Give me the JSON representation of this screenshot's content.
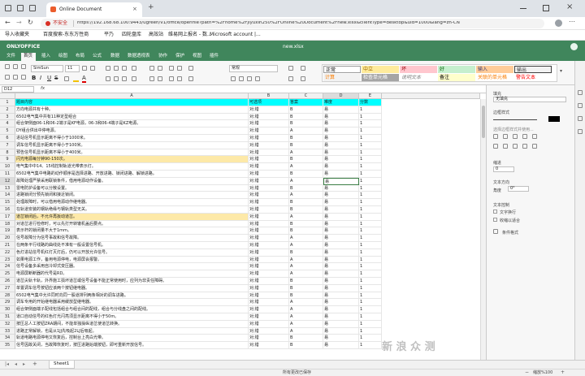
{
  "browser": {
    "tab_title": "Online Document",
    "security_label": "不安全",
    "url": "https://192.168.68.100:9443/ugreen/v1/office/openfile?path=%2Fhome%2Fjiyuxin250%2FOnline%20Document%2Fnew.xlsx&clientType=desktop&uid=1000&lang=zh-CN",
    "bookmarks": [
      "导入收藏夹",
      "百度搜索-东东万性商",
      "平乃",
      "四轮盘库",
      "高效站",
      "维易网上报名 - 数...",
      "Microsoft account |..."
    ]
  },
  "office": {
    "brand": "ONLYOFFICE",
    "doc_title": "new.xlsx",
    "menu_tabs": [
      "文件",
      "首页",
      "插入",
      "绘图",
      "布局",
      "公式",
      "数据",
      "数据透视表",
      "协作",
      "保护",
      "视图",
      "插件"
    ],
    "active_tab": "首页",
    "font_name": "SimSun",
    "font_size": "11",
    "number_format": "常规",
    "cell_styles": [
      {
        "label": "正常",
        "bg": "#ffffff",
        "fg": "#000000"
      },
      {
        "label": "中立",
        "bg": "#ffeb9c",
        "fg": "#9c6500"
      },
      {
        "label": "坏",
        "bg": "#ffc7ce",
        "fg": "#9c0006"
      },
      {
        "label": "好",
        "bg": "#c6efce",
        "fg": "#006100"
      },
      {
        "label": "输入",
        "bg": "#ffcc99",
        "fg": "#3f3f76"
      },
      {
        "label": "输出",
        "bg": "#f2f2f2",
        "fg": "#3f3f3f"
      },
      {
        "label": "计算",
        "bg": "#f2f2f2",
        "fg": "#fa7d00"
      },
      {
        "label": "检查单元格",
        "bg": "#a5a5a5",
        "fg": "#ffffff"
      },
      {
        "label": "说明文本",
        "bg": "#ffffff",
        "fg": "#7f7f7f"
      },
      {
        "label": "备注",
        "bg": "#ffffcc",
        "fg": "#000000"
      },
      {
        "label": "关联的单元格",
        "bg": "#ffffff",
        "fg": "#fa7d00"
      },
      {
        "label": "警告文本",
        "bg": "#ffffff",
        "fg": "#ff0000"
      }
    ],
    "name_box": "D12",
    "formula_fx": "fx",
    "columns": [
      "A",
      "B",
      "C",
      "D",
      "E"
    ],
    "header_row": [
      "题目内容",
      "可选项",
      "答案",
      "难度",
      "分数"
    ],
    "rows": [
      [
        "方向电源共有十种。",
        "对;错",
        "B",
        "易",
        "1"
      ],
      [
        "6502电气集中共有11种定型组合",
        "对;错",
        "B",
        "易",
        "1"
      ],
      [
        "组合架侧面06-1和06-2端子是KF电源，06-3和06-4端子是KZ电源。",
        "对;错",
        "B",
        "易",
        "1"
      ],
      [
        "DY组合供出中停电源。",
        "对;错",
        "A",
        "易",
        "1"
      ],
      [
        "进站信号机显示距离不得小于1000米。",
        "对;错",
        "B",
        "易",
        "1"
      ],
      [
        "调车信号机显示距离不得小于100米。",
        "对;错",
        "B",
        "易",
        "1"
      ],
      [
        "预告信号机显示距离不得小于400米。",
        "对;错",
        "A",
        "易",
        "1"
      ],
      [
        "闪光电源每分钟90-150次。",
        "对;错",
        "B",
        "易",
        "1"
      ],
      [
        "电气集中中14、15线控制轨道光带表示灯。",
        "对;错",
        "A",
        "易",
        "1"
      ],
      [
        "6502电气集中电路的动作顺序是选择进路、开放进路、锁闭进路、解锁进路。",
        "对;错",
        "B",
        "易",
        "1"
      ],
      [
        "故障处理严禁采用联锁条件，借用电源动作设备。",
        "对;错",
        "A",
        "易",
        "1"
      ],
      [
        "雷电防护设备可以分散设置。",
        "对;错",
        "B",
        "易",
        "1"
      ],
      [
        "进路锁闭分预先锁闭和接近锁闭。",
        "对;错",
        "A",
        "易",
        "1"
      ],
      [
        "处理故障时，可以借用电源动作继电器。",
        "对;错",
        "B",
        "易",
        "1"
      ],
      [
        "在轨道安装的钢轨绝缘与钢轨类型无关。",
        "对;错",
        "B",
        "易",
        "1"
      ],
      [
        "道岔锁闭后，不允许再扳动道岔。",
        "对;错",
        "A",
        "易",
        "1"
      ],
      [
        "对道岔进行检修时，可以先打开转辙机盖后要点。",
        "对;错",
        "B",
        "易",
        "1"
      ],
      [
        "表示杆的锁闭量不大于1mm。",
        "对;错",
        "B",
        "易",
        "1"
      ],
      [
        "信号故障分为信号事故和信号故障。",
        "对;错",
        "A",
        "易",
        "1"
      ],
      [
        "在两条平行线路的曲线处不准有一般设置信号机。",
        "对;错",
        "A",
        "易",
        "1"
      ],
      [
        "色灯进站信号机红灯灭灯后，仍可以开放允许信号。",
        "对;错",
        "B",
        "易",
        "1"
      ],
      [
        "如果电源工作，备用电源停电，电源屏会报警。",
        "对;错",
        "A",
        "易",
        "1"
      ],
      [
        "信号设备多采用自冷却式变压器。",
        "对;错",
        "A",
        "易",
        "1"
      ],
      [
        "电源屏断断器的代号是RD。",
        "对;错",
        "A",
        "易",
        "1"
      ],
      [
        "道岔尖轨卡轨，外界施工损坏道岔或信号设备不能正常使用时，应列为非责任障碍。",
        "对;错",
        "B",
        "易",
        "1"
      ],
      [
        "单置调车信号按钮应该两个按钮继电器。",
        "对;错",
        "B",
        "易",
        "1"
      ],
      [
        "6502电气集中允许同时向同一股道排列两条相对的调车进路。",
        "对;错",
        "B",
        "易",
        "1"
      ],
      [
        "调车专用的开始继电器采用缓放型继电器。",
        "对;错",
        "A",
        "易",
        "1"
      ],
      [
        "组合架侧面端子配线包括组合与组合间的配线，组合与分线盘之间的配线。",
        "对;错",
        "A",
        "易",
        "1"
      ],
      [
        "道口自动信号的红色灯光闪亮须显示距离不得小于50m。",
        "对;错",
        "A",
        "易",
        "1"
      ],
      [
        "按压总人工按钮ZRA期间，不能单独操纵道岔使道岔转换。",
        "对;错",
        "A",
        "易",
        "1"
      ],
      [
        "进路正常解锁，也是从1JJ先吸起2LJ后吸起。",
        "对;错",
        "A",
        "易",
        "1"
      ],
      [
        "轨道电路电源停电又恢复后，控制台上亮白光带。",
        "对;错",
        "B",
        "易",
        "1"
      ],
      [
        "信号因故关闭，当故障恢复时，按压进路始端按钮，即可重新开放信号。",
        "对;错",
        "B",
        "易",
        "1"
      ]
    ],
    "highlight_rows": [
      9,
      17
    ],
    "highlight_color": "#fde9a8",
    "header_fill": "#00ffff",
    "selected_row": 12,
    "sheet_tab": "Sheet1",
    "status_center": "所有更改已保存",
    "status_zoom": "缩放%100",
    "panel": {
      "section1_title": "填充",
      "fill_value": "无填充",
      "section2_title": "边框样式",
      "border_hint": "选择边框样式并使用...",
      "section3_title": "文本方向",
      "section3_value": "文本方向",
      "section4_title": "缩进",
      "section4_value": "0",
      "section5_title": "文本方向",
      "angle_label": "角度",
      "angle_value": "0°",
      "section6_title": "文本控制",
      "wrap_label": "文字换行",
      "shrink_label": "收缩以适合",
      "cond_label": "条件格式"
    },
    "watermark": "新 浪 众 测"
  }
}
